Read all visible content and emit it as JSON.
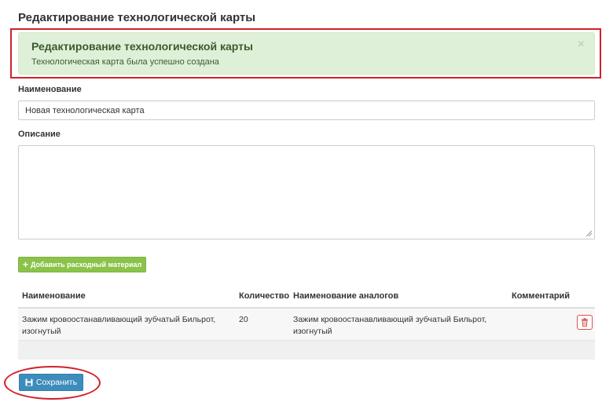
{
  "page": {
    "title": "Редактирование технологической карты"
  },
  "alert": {
    "title": "Редактирование технологической карты",
    "message": "Технологическая карта была успешно создана",
    "close_symbol": "×",
    "color": "#dff0d8",
    "highlight_color": "#d0212a"
  },
  "form": {
    "name_label": "Наименование",
    "name_value": "Новая технологическая карта",
    "description_label": "Описание",
    "description_value": ""
  },
  "add_material_button": {
    "icon": "plus-icon",
    "label": "Добавить расходный материал",
    "color": "#8bc34a"
  },
  "table": {
    "headers": [
      "Наименование",
      "Количество",
      "Наименование аналогов",
      "Комментарий"
    ],
    "rows": [
      {
        "name_line1": "Зажим кровоостанавливающий зубчатый Бильрот,",
        "name_line2": "изогнутый",
        "quantity": "20",
        "analog_line1": "Зажим кровоостанавливающий зубчатый Бильрот,",
        "analog_line2": "изогнутый",
        "comment": "",
        "delete_icon": "trash-icon"
      }
    ]
  },
  "save_button": {
    "icon": "floppy-disk-icon",
    "label": "Сохранить",
    "color": "#3c8dbc"
  }
}
